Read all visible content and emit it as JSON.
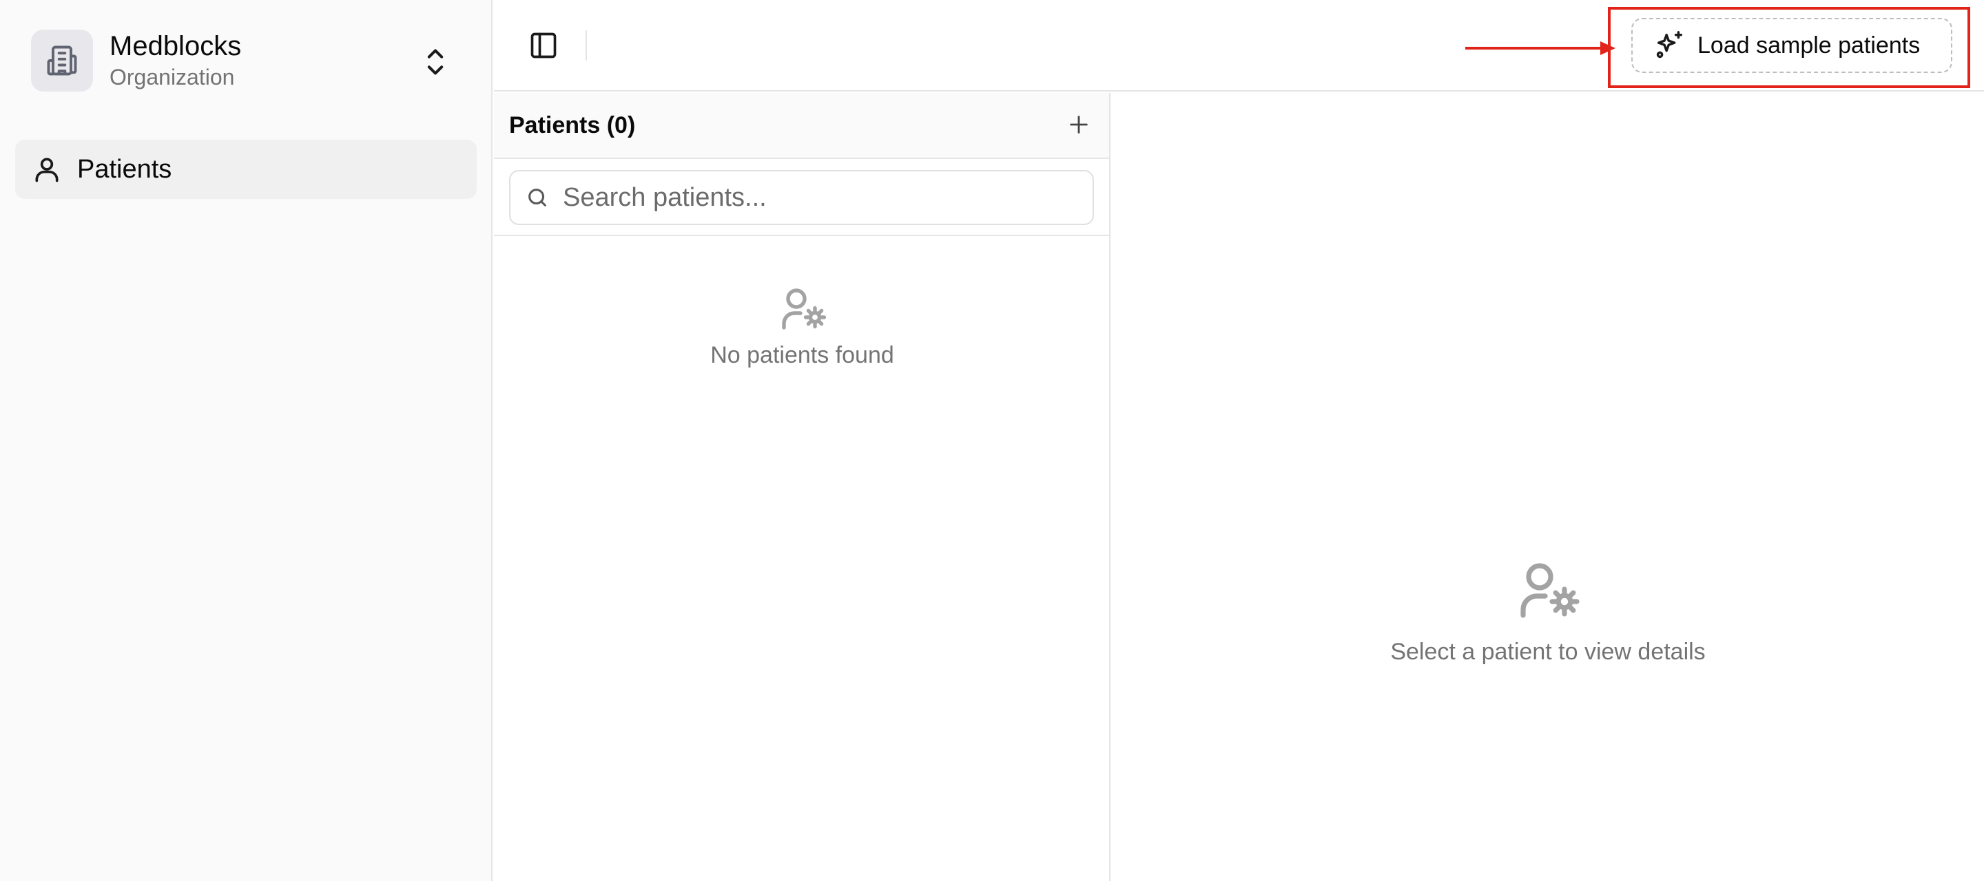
{
  "organization": {
    "name": "Medblocks",
    "subtitle": "Organization"
  },
  "sidebar": {
    "items": [
      {
        "label": "Patients",
        "icon": "user-icon",
        "active": true
      }
    ]
  },
  "toolbar": {
    "load_sample_label": "Load sample patients",
    "highlight_color": "#e2231a"
  },
  "patient_list": {
    "title": "Patients (0)",
    "search": {
      "placeholder": "Search patients...",
      "value": ""
    },
    "empty_text": "No patients found"
  },
  "details": {
    "empty_text": "Select a patient to view details"
  }
}
